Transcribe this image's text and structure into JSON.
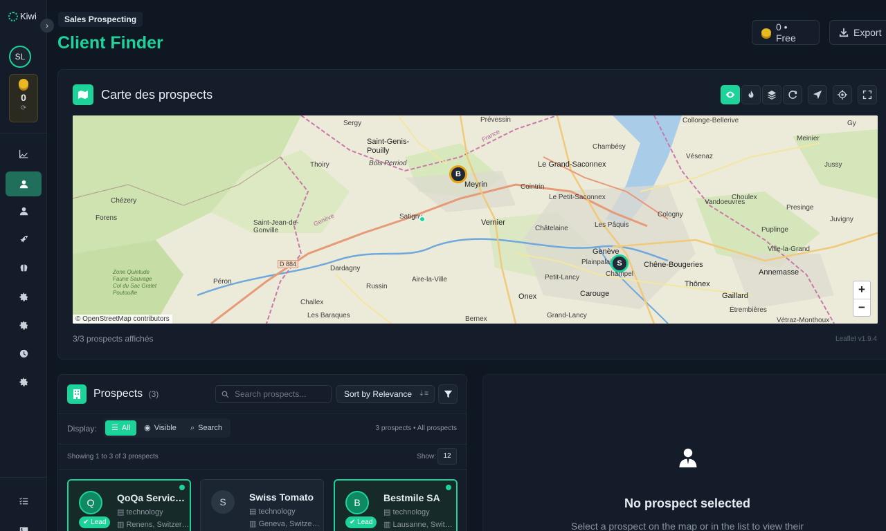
{
  "app": {
    "name": "Kiwi"
  },
  "sidebar": {
    "avatar_initials": "SL",
    "credits_value": "0",
    "nav": [
      {
        "name": "analytics"
      },
      {
        "name": "client-finder",
        "active": true
      },
      {
        "name": "contacts"
      },
      {
        "name": "campaigns"
      },
      {
        "name": "insights"
      },
      {
        "name": "settings-a"
      },
      {
        "name": "settings-b"
      },
      {
        "name": "history"
      },
      {
        "name": "settings-c"
      }
    ]
  },
  "header": {
    "breadcrumb": "Sales Prospecting",
    "title": "Client Finder",
    "credits_label": "0 • Free",
    "export_label": "Export"
  },
  "map": {
    "title": "Carte des prospects",
    "attribution": "© OpenStreetMap contributors",
    "count_text": "3/3 prospects affichés",
    "library": "Leaflet v1.9.4",
    "zoom_in": "+",
    "zoom_out": "−",
    "places": [
      "Sergy",
      "Prévessin",
      "Collonge-Bellerive",
      "Gy",
      "Saint-Genis-Pouilly",
      "Bois Perriod",
      "Thoiry",
      "Meyrin",
      "Le Grand-Saconnex",
      "Chambésy",
      "Vésenaz",
      "Jussy",
      "Meinier",
      "Cointrin",
      "Le Petit-Saconnex",
      "Choulex",
      "Presinge",
      "Vandoeuvres",
      "Chézery",
      "Forens",
      "Saint-Jean-de-Gonville",
      "Satigny",
      "Vernier",
      "Châtelaine",
      "Les Pâquis",
      "Cologny",
      "Puplinge",
      "Juvigny",
      "Genève",
      "Plainpalais",
      "Chêne-Bougeries",
      "Ville-la-Grand",
      "Champel",
      "Annemasse",
      "Zone Quietude Faune Sauvage Col du Sac Gralet Poutouille",
      "D 884",
      "Dardagny",
      "Péron",
      "Russin",
      "Aire-la-Ville",
      "Petit-Lancy",
      "Carouge",
      "Thônex",
      "Gaillard",
      "Challex",
      "Onex",
      "Étrembières",
      "Les Baraques",
      "Bernex",
      "Grand-Lancy",
      "Vétraz-Monthoux",
      "France",
      "Genève"
    ],
    "markers": [
      {
        "label": "B"
      },
      {
        "label": "S"
      }
    ]
  },
  "prospects": {
    "title": "Prospects",
    "count": "(3)",
    "search_placeholder": "Search prospects...",
    "sort_label": "Sort by Relevance",
    "display_label": "Display:",
    "filters": [
      "All",
      "Visible",
      "Search"
    ],
    "summary": "3 prospects • All prospects",
    "showing": "Showing 1 to 3 of 3 prospects",
    "show_label": "Show:",
    "page_size": "12",
    "items": [
      {
        "initial": "Q",
        "name": "QoQa Services SA",
        "industry": "technology",
        "location": "Renens, Switzerland",
        "badge": "Lead"
      },
      {
        "initial": "S",
        "name": "Swiss Tomato",
        "industry": "technology",
        "location": "Geneva, Switzerland",
        "badge": ""
      },
      {
        "initial": "B",
        "name": "Bestmile SA",
        "industry": "technology",
        "location": "Lausanne, Switzerland",
        "badge": "Lead"
      }
    ]
  },
  "detail": {
    "empty_title": "No prospect selected",
    "empty_hint": "Select a prospect on the map or in the list to view their"
  },
  "colors": {
    "accent": "#1ed39a",
    "background": "#0f1722",
    "marker_ring": "#e8a317"
  }
}
